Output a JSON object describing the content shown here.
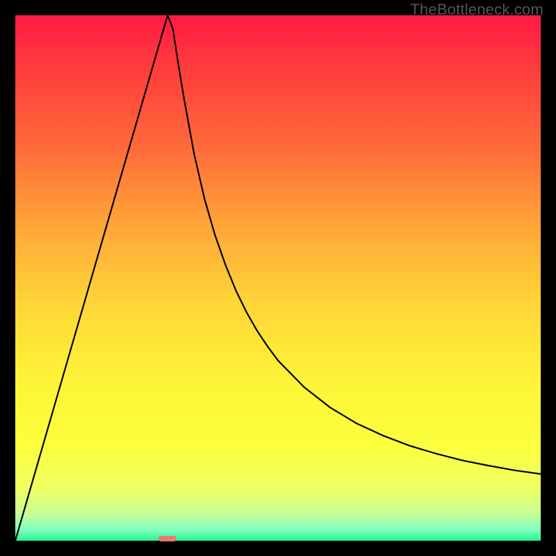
{
  "watermark": "TheBottleneck.com",
  "chart_data": {
    "type": "line",
    "title": "",
    "xlabel": "",
    "ylabel": "",
    "xlim": [
      0,
      1
    ],
    "ylim": [
      0,
      1
    ],
    "grid": false,
    "legend": false,
    "annotations": [],
    "x": [
      0.0,
      0.02,
      0.04,
      0.06,
      0.08,
      0.1,
      0.12,
      0.14,
      0.16,
      0.18,
      0.2,
      0.22,
      0.24,
      0.26,
      0.28,
      0.29,
      0.3,
      0.31,
      0.32,
      0.34,
      0.36,
      0.38,
      0.4,
      0.42,
      0.44,
      0.46,
      0.48,
      0.5,
      0.55,
      0.6,
      0.65,
      0.7,
      0.75,
      0.8,
      0.85,
      0.9,
      0.95,
      1.0
    ],
    "y": [
      0.0,
      0.069,
      0.138,
      0.207,
      0.276,
      0.345,
      0.414,
      0.483,
      0.552,
      0.621,
      0.69,
      0.759,
      0.828,
      0.897,
      0.966,
      1.0,
      0.974,
      0.909,
      0.848,
      0.738,
      0.651,
      0.582,
      0.525,
      0.476,
      0.435,
      0.4,
      0.37,
      0.343,
      0.292,
      0.253,
      0.223,
      0.2,
      0.181,
      0.166,
      0.153,
      0.143,
      0.134,
      0.127
    ],
    "marker": {
      "x": 0.29,
      "width": 0.035
    },
    "gradient_stops": [
      {
        "pos": 0.0,
        "color": "#ff1a45"
      },
      {
        "pos": 0.1,
        "color": "#ff3c3c"
      },
      {
        "pos": 0.25,
        "color": "#ff6a3a"
      },
      {
        "pos": 0.4,
        "color": "#ffa538"
      },
      {
        "pos": 0.55,
        "color": "#ffd638"
      },
      {
        "pos": 0.7,
        "color": "#fff438"
      },
      {
        "pos": 0.82,
        "color": "#fbff3d"
      },
      {
        "pos": 0.9,
        "color": "#f0ff62"
      },
      {
        "pos": 0.95,
        "color": "#c4ff97"
      },
      {
        "pos": 0.98,
        "color": "#7dffc3"
      },
      {
        "pos": 1.0,
        "color": "#26f58f"
      }
    ]
  }
}
